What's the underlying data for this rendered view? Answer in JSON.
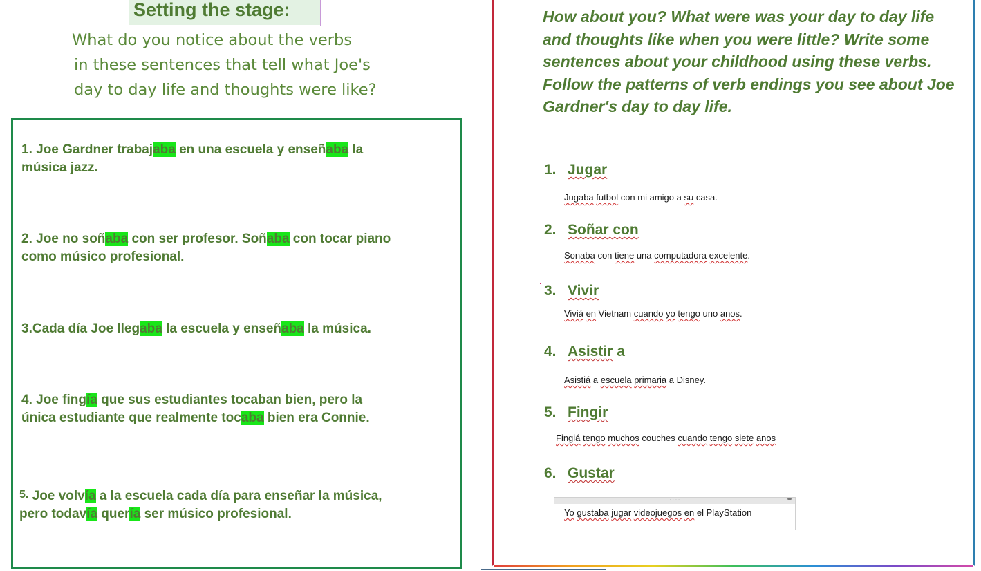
{
  "left": {
    "title": "Setting the stage:",
    "intro_lines": [
      "What do you notice about the verbs",
      "in these sentences that tell what Joe's",
      "day to day life and thoughts were like?"
    ],
    "sentences": [
      {
        "line1": [
          {
            "t": "1. Joe Gardner trabaj",
            "h": false
          },
          {
            "t": "aba",
            "h": true
          },
          {
            "t": " en una escuela y enseñ",
            "h": false
          },
          {
            "t": "aba",
            "h": true
          },
          {
            "t": " la",
            "h": false
          }
        ],
        "line2": [
          {
            "t": "música jazz.",
            "h": false
          }
        ]
      },
      {
        "line1": [
          {
            "t": "2. Joe no soñ",
            "h": false
          },
          {
            "t": "aba",
            "h": true
          },
          {
            "t": " con ser profesor.  Soñ",
            "h": false
          },
          {
            "t": "aba",
            "h": true
          },
          {
            "t": " con tocar piano",
            "h": false
          }
        ],
        "line2": [
          {
            "t": "como músico profesional.",
            "h": false
          }
        ]
      },
      {
        "line1": [
          {
            "t": "3.Cada día Joe lleg",
            "h": false
          },
          {
            "t": "aba",
            "h": true
          },
          {
            "t": " la escuela y enseñ",
            "h": false
          },
          {
            "t": "aba",
            "h": true
          },
          {
            "t": " la música.",
            "h": false
          }
        ],
        "line2": []
      },
      {
        "line1": [
          {
            "t": "4. Joe fing",
            "h": false
          },
          {
            "t": "ía",
            "h": true
          },
          {
            "t": " que sus estudiantes tocaban bien, pero la",
            "h": false
          }
        ],
        "line2": [
          {
            "t": "única estudiante que realmente toc",
            "h": false
          },
          {
            "t": "aba",
            "h": true
          },
          {
            "t": " bien era Connie.",
            "h": false
          }
        ]
      },
      {
        "num": "5.",
        "line1": [
          {
            "t": " Joe volv",
            "h": false
          },
          {
            "t": "ía",
            "h": true
          },
          {
            "t": " a la escuela cada día para enseñar la música,",
            "h": false
          }
        ],
        "line2": [
          {
            "t": "pero todav",
            "h": false
          },
          {
            "t": "ía",
            "h": true
          },
          {
            "t": " quer",
            "h": false
          },
          {
            "t": "ía",
            "h": true
          },
          {
            "t": " ser músico profesional.",
            "h": false
          }
        ]
      }
    ]
  },
  "right": {
    "prompt_lines": [
      "How about you?  What were was your day to day life",
      "and thoughts like when you were little? Write some",
      "sentences about your childhood using these verbs.",
      "Follow the patterns of verb endings you see about Joe",
      "Gardner's day to day life."
    ],
    "verbs": [
      {
        "num": "1.",
        "word": "Jugar",
        "rest": "",
        "answer": [
          {
            "t": "Jugaba",
            "sq": true
          },
          {
            "t": " ",
            "sq": false
          },
          {
            "t": "futbol",
            "sq": true
          },
          {
            "t": " con mi amigo a ",
            "sq": false
          },
          {
            "t": "su",
            "sq": true
          },
          {
            "t": " casa.",
            "sq": false
          }
        ]
      },
      {
        "num": "2.",
        "word": "Soñar con",
        "rest": "",
        "answer": [
          {
            "t": "Sonaba",
            "sq": true
          },
          {
            "t": " con ",
            "sq": false
          },
          {
            "t": "tiene",
            "sq": true
          },
          {
            "t": " una ",
            "sq": false
          },
          {
            "t": "computadora",
            "sq": true
          },
          {
            "t": " ",
            "sq": false
          },
          {
            "t": "excelente",
            "sq": true
          },
          {
            "t": ".",
            "sq": false
          }
        ]
      },
      {
        "num": "3.",
        "word": "Vivir",
        "rest": "",
        "answer": [
          {
            "t": "Viviá",
            "sq": true
          },
          {
            "t": " ",
            "sq": false
          },
          {
            "t": "en",
            "sq": true
          },
          {
            "t": " Vietnam ",
            "sq": false
          },
          {
            "t": "cuando",
            "sq": true
          },
          {
            "t": " ",
            "sq": false
          },
          {
            "t": "yo",
            "sq": true
          },
          {
            "t": " ",
            "sq": false
          },
          {
            "t": "tengo",
            "sq": true
          },
          {
            "t": " uno ",
            "sq": false
          },
          {
            "t": "anos",
            "sq": true
          },
          {
            "t": ".",
            "sq": false
          }
        ]
      },
      {
        "num": "4.",
        "word": "Asistir",
        "rest": " a",
        "answer": [
          {
            "t": "Asistiá",
            "sq": true
          },
          {
            "t": " a ",
            "sq": false
          },
          {
            "t": "escuela",
            "sq": true
          },
          {
            "t": " ",
            "sq": false
          },
          {
            "t": "primaria",
            "sq": true
          },
          {
            "t": " a Disney.",
            "sq": false
          }
        ]
      },
      {
        "num": "5.",
        "word": "Fingir",
        "rest": "",
        "answer": [
          {
            "t": "Fingiá",
            "sq": true
          },
          {
            "t": " ",
            "sq": false
          },
          {
            "t": "tengo",
            "sq": true
          },
          {
            "t": " ",
            "sq": false
          },
          {
            "t": "muchos",
            "sq": true
          },
          {
            "t": " couches ",
            "sq": false
          },
          {
            "t": "cuando",
            "sq": true
          },
          {
            "t": " ",
            "sq": false
          },
          {
            "t": "tengo",
            "sq": true
          },
          {
            "t": " ",
            "sq": false
          },
          {
            "t": "siete",
            "sq": true
          },
          {
            "t": " ",
            "sq": false
          },
          {
            "t": "anos",
            "sq": true
          }
        ]
      },
      {
        "num": "6.",
        "word": "Gustar",
        "rest": "",
        "answer": [
          {
            "t": "Yo",
            "sq": true
          },
          {
            "t": " ",
            "sq": false
          },
          {
            "t": "gustaba",
            "sq": true
          },
          {
            "t": " ",
            "sq": false
          },
          {
            "t": "jugar",
            "sq": true
          },
          {
            "t": " ",
            "sq": false
          },
          {
            "t": "videojuegos",
            "sq": true
          },
          {
            "t": " ",
            "sq": false
          },
          {
            "t": "en",
            "sq": true
          },
          {
            "t": " el PlayStation",
            "sq": false
          }
        ]
      }
    ],
    "answer_box": {
      "grip_icon": "grip-dots-icon",
      "arrows_icon": "resize-arrows-icon",
      "grip_glyph": "....",
      "arrows_glyph": "◂▸"
    }
  }
}
